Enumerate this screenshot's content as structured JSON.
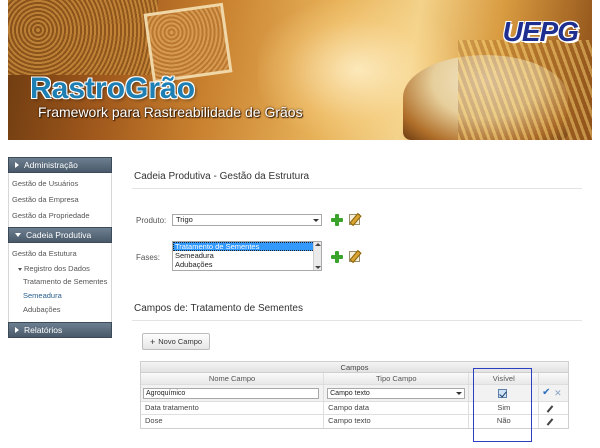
{
  "banner": {
    "brand": "RastroGrão",
    "tagline": "Framework para Rastreabilidade de Grãos",
    "institution_logo": "UEPG"
  },
  "sidebar": {
    "sections": [
      {
        "title": "Administração",
        "expanded": true,
        "items": [
          "Gestão de Usuários",
          "Gestão da Empresa",
          "Gestão da Propriedade"
        ]
      },
      {
        "title": "Cadeia Produtiva",
        "expanded": true,
        "items": [
          "Gestão da Estutura"
        ],
        "subgroup": {
          "label": "Registro dos Dados",
          "items": [
            "Tratamento de Sementes",
            "Semeadura",
            "Adubações"
          ]
        }
      },
      {
        "title": "Relatórios",
        "expanded": false,
        "items": []
      }
    ]
  },
  "main": {
    "page_title": "Cadeia Produtiva - Gestão da Estrutura",
    "produto": {
      "label": "Produto:",
      "value": "Trigo"
    },
    "fases": {
      "label": "Fases:",
      "options": [
        "Tratamento de Sementes",
        "Semeadura",
        "Adubações"
      ],
      "selected": "Tratamento de Sementes"
    },
    "campos_title": "Campos de: Tratamento de Sementes",
    "new_button": "Novo Campo",
    "table": {
      "caption": "Campos",
      "columns": [
        "Nome Campo",
        "Tipo Campo",
        "Visível",
        ""
      ],
      "edit_row": {
        "nome": "Agroquímico",
        "tipo": "Campo texto",
        "visivel": true
      },
      "rows": [
        {
          "nome": "Data tratamento",
          "tipo": "Campo data",
          "visivel": "Sim"
        },
        {
          "nome": "Dose",
          "tipo": "Campo texto",
          "visivel": "Não"
        }
      ]
    }
  },
  "colors": {
    "accent": "#2b3fc2",
    "sidebar_header": "#49596a",
    "brand": "#1d7fb3",
    "add_icon": "#3aa32c"
  }
}
